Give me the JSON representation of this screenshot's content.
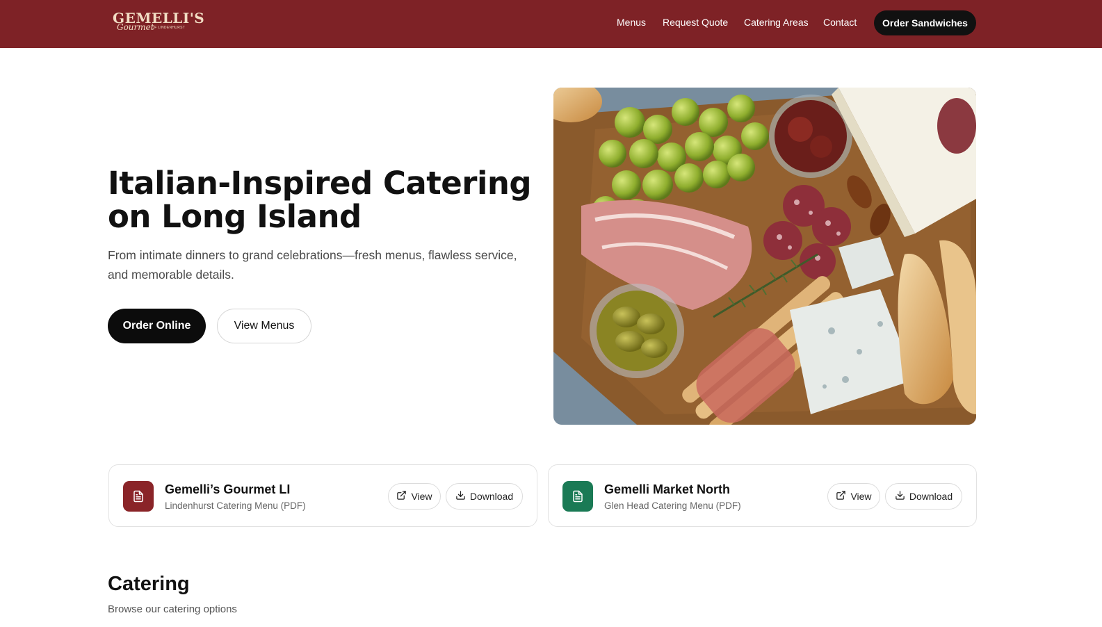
{
  "brand": {
    "logo_text": "GEMELLI'S",
    "logo_script": "Gourmet",
    "logo_small": "OF LINDENHURST",
    "header_color": "#7e2226"
  },
  "nav": {
    "items": [
      "Menus",
      "Request Quote",
      "Catering Areas",
      "Contact"
    ],
    "cta": "Order Sandwiches"
  },
  "hero": {
    "title": "Italian-Inspired Catering on Long Island",
    "subtitle": "From intimate dinners to grand celebrations—fresh menus, flawless service, and memorable details.",
    "primary_button": "Order Online",
    "secondary_button": "View Menus"
  },
  "menu_cards": [
    {
      "title": "Gemelli’s Gourmet LI",
      "subtitle": "Lindenhurst Catering Menu (PDF)",
      "icon": "document-icon",
      "icon_color": "#8a2428",
      "view_label": "View",
      "download_label": "Download"
    },
    {
      "title": "Gemelli Market North",
      "subtitle": "Glen Head Catering Menu (PDF)",
      "icon": "document-icon",
      "icon_color": "#1a7a55",
      "view_label": "View",
      "download_label": "Download"
    }
  ],
  "catering": {
    "title": "Catering",
    "subtitle": "Browse our catering options"
  }
}
